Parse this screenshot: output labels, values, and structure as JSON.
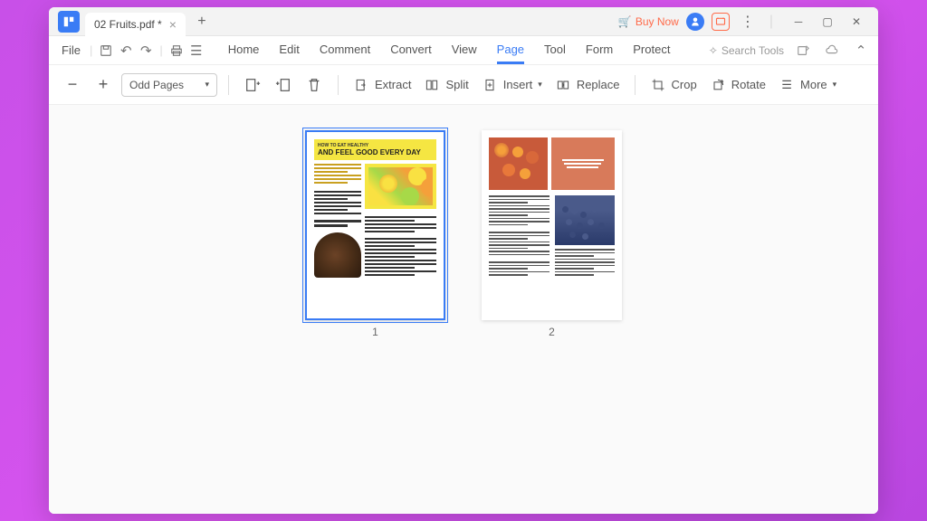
{
  "titlebar": {
    "app_glyph": "⬜",
    "tab_title": "02 Fruits.pdf *",
    "buy_now": "Buy Now"
  },
  "menubar": {
    "file": "File",
    "tabs": [
      "Home",
      "Edit",
      "Comment",
      "Convert",
      "View",
      "Page",
      "Tool",
      "Form",
      "Protect"
    ],
    "active_tab": "Page",
    "search_tools": "Search Tools"
  },
  "toolbar": {
    "page_select": "Odd Pages",
    "extract": "Extract",
    "split": "Split",
    "insert": "Insert",
    "replace": "Replace",
    "crop": "Crop",
    "rotate": "Rotate",
    "more": "More"
  },
  "pages": {
    "page1": {
      "number": "1",
      "subtitle": "HOW TO EAT HEALTHY",
      "title": "AND FEEL GOOD EVERY DAY"
    },
    "page2": {
      "number": "2"
    }
  }
}
